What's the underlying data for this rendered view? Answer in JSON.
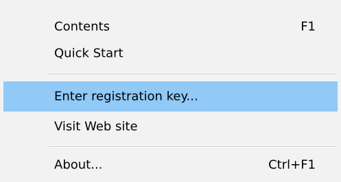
{
  "menu": {
    "items": [
      {
        "label": "Contents",
        "shortcut": "F1"
      },
      {
        "label": "Quick Start",
        "shortcut": ""
      },
      {
        "label": "Enter registration key...",
        "shortcut": ""
      },
      {
        "label": "Visit Web site",
        "shortcut": ""
      },
      {
        "label": "About...",
        "shortcut": "Ctrl+F1"
      }
    ],
    "highlighted_item": "Enter registration key...",
    "colors": {
      "background": "#f2f2f2",
      "highlight": "#91c9f7",
      "separator": "#d0d0d0"
    }
  }
}
